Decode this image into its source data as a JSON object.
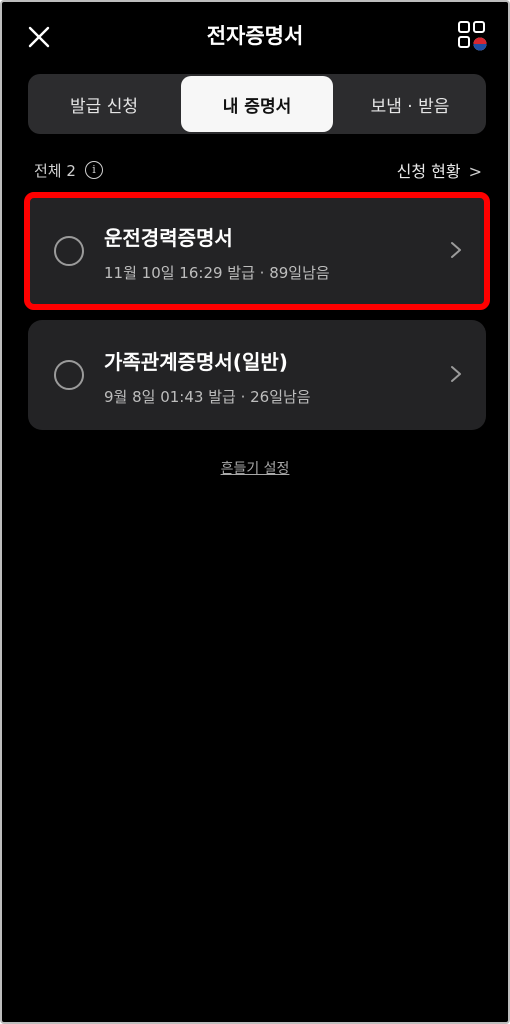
{
  "header": {
    "title": "전자증명서",
    "close_icon": "close-icon",
    "menu_icon": "grid-menu-icon"
  },
  "tabs": [
    {
      "label": "발급 신청",
      "selected": false
    },
    {
      "label": "내 증명서",
      "selected": true
    },
    {
      "label": "보냄 · 받음",
      "selected": false
    }
  ],
  "summary": {
    "total_label": "전체 2",
    "info_icon": "info-icon",
    "status_link": "신청 현황",
    "status_chevron": ">"
  },
  "certificates": [
    {
      "title": "운전경력증명서",
      "subtitle": "11월 10일 16:29 발급 · 89일남음",
      "highlighted": true
    },
    {
      "title": "가족관계증명서(일반)",
      "subtitle": "9월 8일 01:43 발급 · 26일남음",
      "highlighted": false
    }
  ],
  "footer": {
    "shake_settings": "흔들기 설정"
  },
  "colors": {
    "background": "#000000",
    "card": "#232325",
    "tab_bar": "#2c2c2e",
    "tab_selected": "#f7f7f7",
    "highlight": "#ff0000"
  }
}
